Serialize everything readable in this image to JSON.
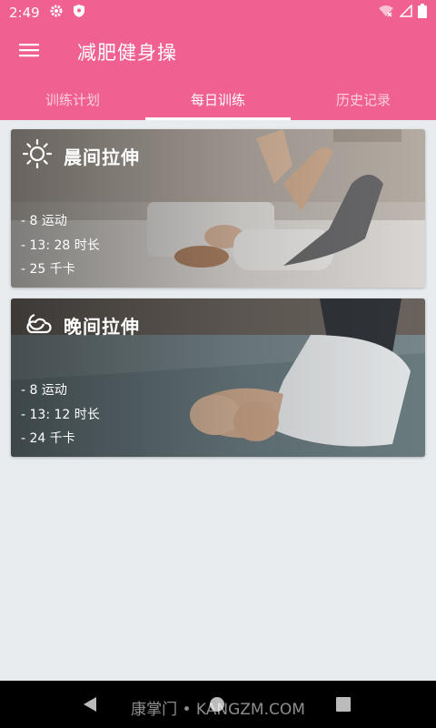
{
  "status_bar": {
    "time": "2:49",
    "icons": [
      "gear-icon",
      "shield-icon",
      "wifi-icon",
      "signal-icon",
      "battery-icon"
    ]
  },
  "app_bar": {
    "title": "减肥健身操",
    "menu_icon": "hamburger-menu-icon"
  },
  "tabs": [
    {
      "label": "训练计划",
      "active": false
    },
    {
      "label": "每日训练",
      "active": true
    },
    {
      "label": "历史记录",
      "active": false
    }
  ],
  "cards": [
    {
      "title": "晨间拉伸",
      "icon": "sun-icon",
      "stats": [
        "- 8 运动",
        "- 13: 28 时长",
        "- 25 千卡"
      ]
    },
    {
      "title": "晚间拉伸",
      "icon": "moon-cloud-icon",
      "stats": [
        "- 8 运动",
        "- 13: 12 时长",
        "- 24 千卡"
      ]
    }
  ],
  "watermark": "康掌门 • KANGZM.COM",
  "colors": {
    "primary": "#f06091",
    "background": "#e8ecef",
    "nav_bar": "#000000"
  }
}
